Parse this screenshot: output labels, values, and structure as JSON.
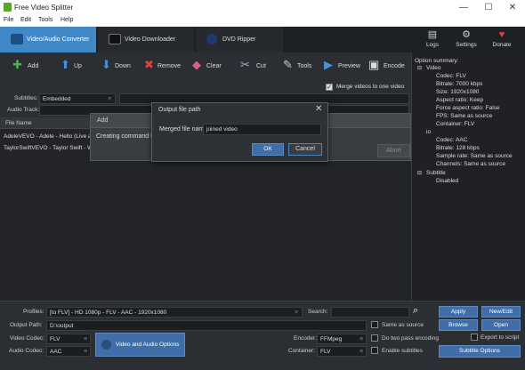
{
  "window": {
    "title": "Free Video Splitter",
    "minimize": "—",
    "maximize": "☐",
    "close": "✕"
  },
  "menu": [
    "File",
    "Edit",
    "Tools",
    "Help"
  ],
  "tabs": [
    {
      "label": "Video/Audio Converter",
      "active": true
    },
    {
      "label": "Video Downloader"
    },
    {
      "label": "DVD Ripper"
    }
  ],
  "topright": [
    {
      "label": "Logs",
      "icon": "logs-icon"
    },
    {
      "label": "Settings",
      "icon": "gear-icon"
    },
    {
      "label": "Donate",
      "icon": "heart-icon"
    }
  ],
  "toolbar": [
    {
      "label": "Add",
      "icon": "plus-icon",
      "glyph": "✚",
      "color": "#4fb34f"
    },
    {
      "label": "Up",
      "icon": "arrow-up-icon",
      "glyph": "⬆",
      "color": "#4a90d9"
    },
    {
      "label": "Down",
      "icon": "arrow-down-icon",
      "glyph": "⬇",
      "color": "#4a90d9"
    },
    {
      "label": "Remove",
      "icon": "remove-icon",
      "glyph": "✖",
      "color": "#e0433a"
    },
    {
      "label": "Clear",
      "icon": "eraser-icon",
      "glyph": "◆",
      "color": "#e05a8a"
    },
    {
      "label": "Cut",
      "icon": "scissors-icon",
      "glyph": "✂",
      "color": "#9bb8d8"
    },
    {
      "label": "Tools",
      "icon": "tools-icon",
      "glyph": "✎",
      "color": "#cccccc"
    },
    {
      "label": "Preview",
      "icon": "play-icon",
      "glyph": "▶",
      "color": "#4a90d9"
    },
    {
      "label": "Encode",
      "icon": "encode-icon",
      "glyph": "▣",
      "color": "#dddddd"
    }
  ],
  "merge_label": "Merge videos to one video",
  "subtitles": {
    "label": "Subtitles:",
    "value": "Embedded"
  },
  "audio_track": {
    "label": "Audio Track:"
  },
  "list": {
    "header": "File Name",
    "items": [
      "AdeleVEVO - Adele - Hello (Live at",
      "TaylorSwiftVEVO - Taylor Swift - W"
    ]
  },
  "progress_dialog": {
    "title": "Add",
    "text": "Creating command line",
    "abort": "Abort"
  },
  "dialog": {
    "title": "Output file path",
    "field_label": "Merged file name",
    "field_value": "joined video",
    "ok": "OK",
    "cancel": "Cancel"
  },
  "summary": {
    "title": "Option summary:",
    "video": "Video",
    "video_items": [
      "Codec: FLV",
      "Bitrate: 7000 kbps",
      "Size: 1920x1080",
      "Aspect ratio: Keep",
      "Force aspect ratio: False",
      "FPS: Same as source",
      "Container: FLV"
    ],
    "audio_tail": "io",
    "audio_items": [
      "Codec: AAC",
      "Bitrate: 128 kbps",
      "Sample rate: Same as source",
      "Channels: Same as source"
    ],
    "subtitle": "Subtitle",
    "subtitle_items": [
      "Disabled"
    ]
  },
  "bottom": {
    "profiles_label": "Profiles:",
    "profiles_value": "[to FLV] - HD 1080p - FLV - AAC - 1920x1080",
    "search_label": "Search:",
    "output_label": "Output Path:",
    "output_value": "D:\\output",
    "video_codec_label": "Video Codec:",
    "video_codec_value": "FLV",
    "audio_codec_label": "Audio Codec:",
    "audio_codec_value": "AAC",
    "va_options": "Video and Audio Options",
    "encoder_label": "Encoder:",
    "encoder_value": "FFMpeg",
    "container_label": "Container:",
    "container_value": "FLV",
    "same_as_source": "Same as source",
    "two_pass": "Do two pass encoding",
    "enable_subs": "Enable subtitles",
    "apply": "Apply",
    "new_edit": "New/Edit",
    "browse": "Browse",
    "open": "Open",
    "export": "Export to script",
    "subtitle_options": "Subtitle Options"
  }
}
